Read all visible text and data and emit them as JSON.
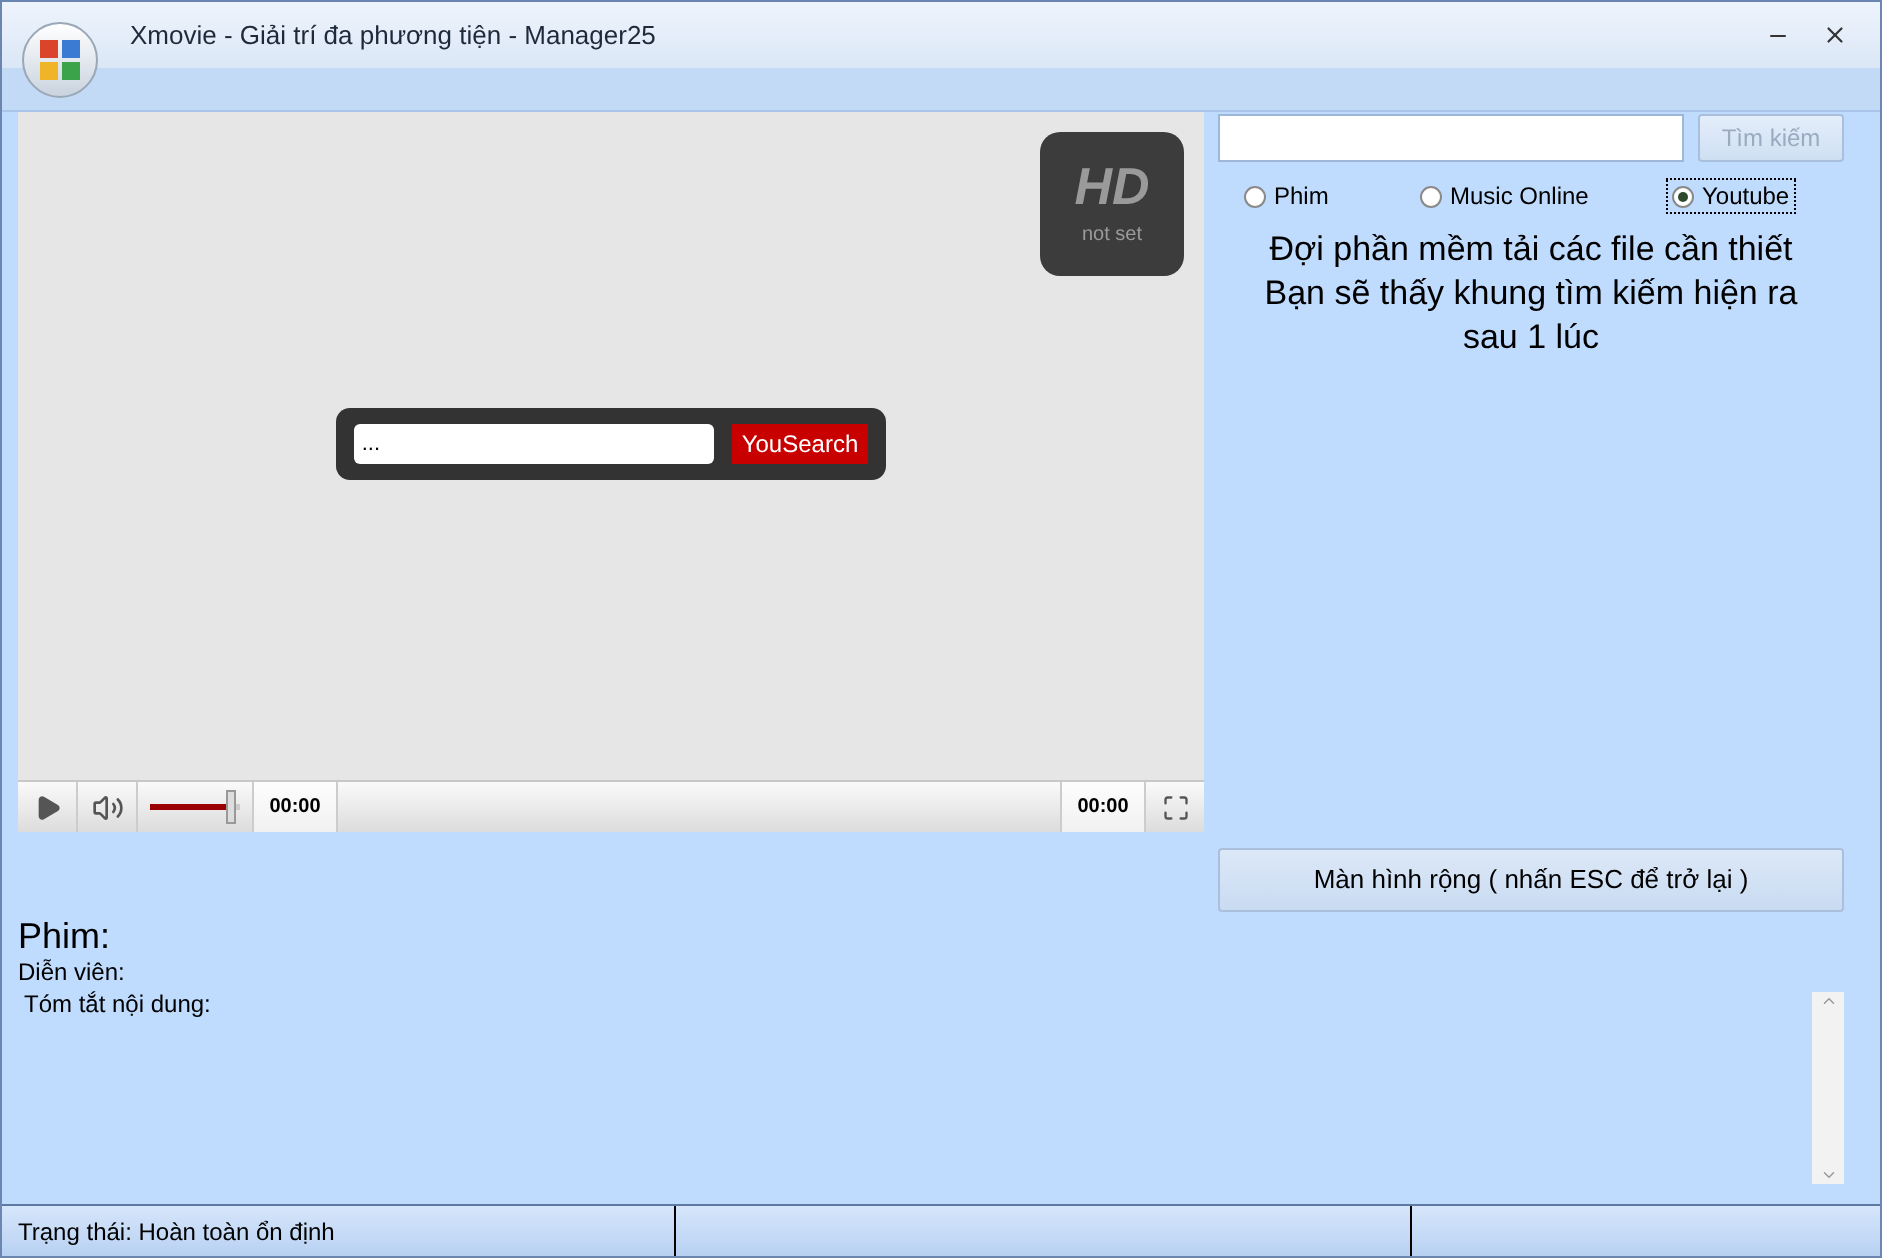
{
  "window": {
    "title": "Xmovie - Giải trí đa phương tiện - Manager25"
  },
  "player": {
    "hd_badge": {
      "label": "HD",
      "status": "not set"
    },
    "search": {
      "value": "...",
      "button": "YouSearch"
    },
    "volume": {
      "level": 0.88
    },
    "time_elapsed": "00:00",
    "time_total": "00:00"
  },
  "search_panel": {
    "button": "Tìm kiếm",
    "button_disabled": true,
    "sources": [
      {
        "label": "Phim",
        "selected": false
      },
      {
        "label": "Music Online",
        "selected": false
      },
      {
        "label": "Youtube",
        "selected": true
      }
    ],
    "message": [
      "Đợi phần mềm tải các file cần thiết",
      "Bạn sẽ thấy khung tìm kiếm hiện ra",
      "sau 1 lúc"
    ],
    "fullscreen_button": "Màn hình rộng ( nhấn ESC để trở lại )"
  },
  "details": {
    "title": "Phim:",
    "actors": "Diễn viên:",
    "summary": "Tóm tắt nội dung:"
  },
  "status_bar": {
    "status": "Trạng thái: Hoàn toàn ổn định"
  }
}
